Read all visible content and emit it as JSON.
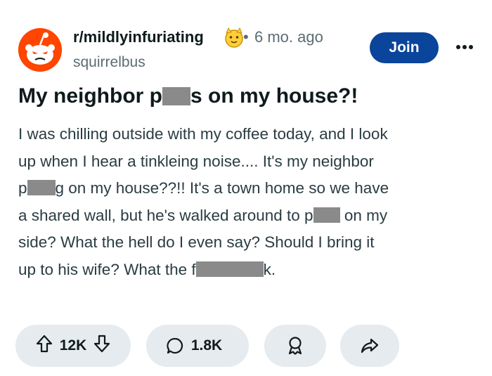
{
  "post": {
    "subreddit": "r/mildlyinfuriating",
    "dot": "•",
    "time": "6 mo. ago",
    "username": "squirrelbus",
    "join_label": "Join",
    "title_part1": "My neighbor p",
    "title_part2": "s on my house?!",
    "body_lines": [
      {
        "a": "I was chilling outside with my coffee today, and I look"
      },
      {
        "a": "up when I hear a tinkleing noise.... It's my neighbor"
      },
      {
        "a": "p",
        "b": "g on my house??!! It's a town home so we have"
      },
      {
        "a": "a shared wall, but he's walked around to p",
        "b": " on my"
      },
      {
        "a": "side? What the hell do I even say? Should I bring it"
      },
      {
        "a": "up to his wife? What the f",
        "b": "k."
      }
    ]
  },
  "actions": {
    "upvotes": "12K",
    "comments": "1.8K"
  },
  "colors": {
    "join_bg": "#0a449b",
    "avatar_bg": "#ff4500",
    "pill_bg": "#e5ebee"
  }
}
